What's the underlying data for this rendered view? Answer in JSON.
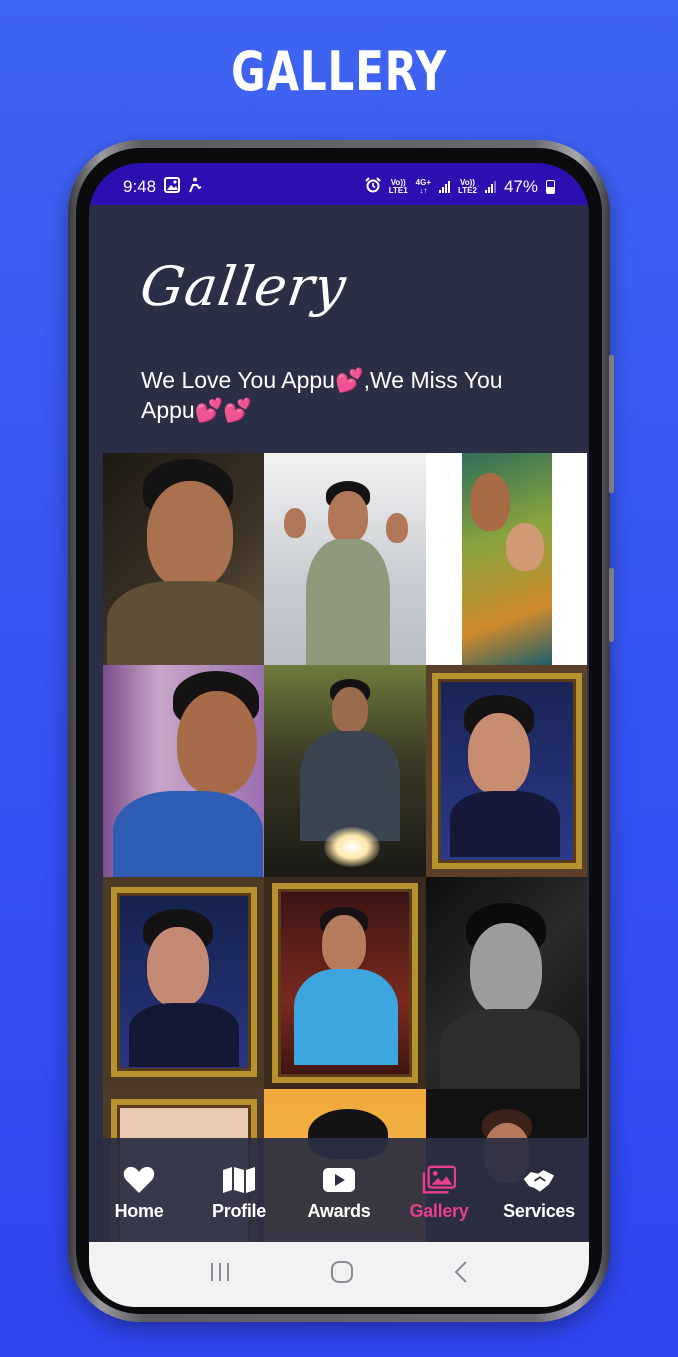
{
  "promo": {
    "title": "GALLERY"
  },
  "status_bar": {
    "time": "9:48",
    "network": {
      "sim1_top": "Vo))",
      "sim1_bottom": "LTE1",
      "gen": "4G+",
      "gen_bottom": "↓↑",
      "sim2_top": "Vo))",
      "sim2_bottom": "LTE2"
    },
    "battery": "47%"
  },
  "header": {
    "title": "Gallery",
    "tagline": "We Love You Appu💕,We Miss You Appu💕💕"
  },
  "gallery": {
    "photos": [
      {
        "desc": "smiling portrait"
      },
      {
        "desc": "thumbs up green t-shirt"
      },
      {
        "desc": "painting with child"
      },
      {
        "desc": "stage portrait with headset"
      },
      {
        "desc": "on motorcycle"
      },
      {
        "desc": "framed painting"
      },
      {
        "desc": "framed painting"
      },
      {
        "desc": "framed painting blue shirt"
      },
      {
        "desc": "black and white portrait"
      },
      {
        "desc": "framed painting partial"
      },
      {
        "desc": "portrait partial"
      },
      {
        "desc": "portrait partial"
      }
    ]
  },
  "bottom_nav": {
    "active_color": "#e83e8c",
    "inactive_color": "#ffffff",
    "items": [
      {
        "label": "Home",
        "icon": "heart-icon"
      },
      {
        "label": "Profile",
        "icon": "map-icon"
      },
      {
        "label": "Awards",
        "icon": "video-play-icon"
      },
      {
        "label": "Gallery",
        "icon": "images-icon",
        "active": true
      },
      {
        "label": "Services",
        "icon": "handshake-icon"
      }
    ]
  },
  "system_nav": {
    "buttons": [
      "recent-apps",
      "home",
      "back"
    ]
  }
}
